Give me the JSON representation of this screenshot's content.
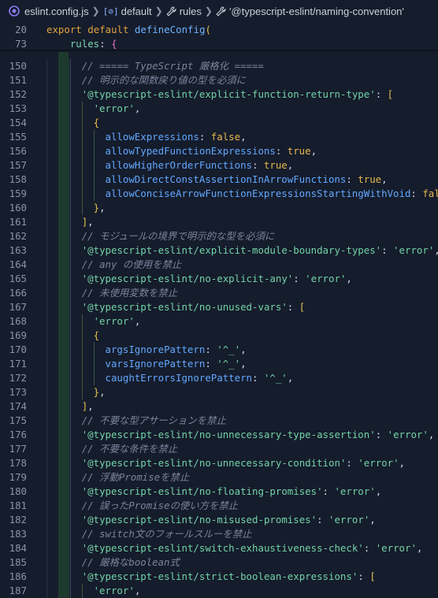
{
  "breadcrumb": {
    "file": "eslint.config.js",
    "items": [
      "default",
      "rules",
      "'@typescript-eslint/naming-convention'"
    ]
  },
  "sticky": [
    {
      "line": "20",
      "tokens": [
        [
          "k",
          "export"
        ],
        [
          "punc",
          " "
        ],
        [
          "k",
          "default"
        ],
        [
          "punc",
          " "
        ],
        [
          "f",
          "defineConfig"
        ],
        [
          "y",
          "("
        ]
      ]
    },
    {
      "line": "73",
      "tokens": [
        [
          "punc",
          "    "
        ],
        [
          "p",
          "rules"
        ],
        [
          "punc",
          ": "
        ],
        [
          "pk",
          "{"
        ]
      ]
    }
  ],
  "lines": [
    {
      "n": "150",
      "indent": 3,
      "tokens": [
        [
          "c",
          "// ===== TypeScript 厳格化 ====="
        ]
      ]
    },
    {
      "n": "151",
      "indent": 3,
      "tokens": [
        [
          "c",
          "// 明示的な関数戻り値の型を必須に"
        ]
      ]
    },
    {
      "n": "152",
      "indent": 3,
      "tokens": [
        [
          "s",
          "'@typescript-eslint/explicit-function-return-type'"
        ],
        [
          "punc",
          ": "
        ],
        [
          "y",
          "["
        ]
      ]
    },
    {
      "n": "153",
      "indent": 4,
      "tokens": [
        [
          "s",
          "'error'"
        ],
        [
          "punc",
          ","
        ]
      ]
    },
    {
      "n": "154",
      "indent": 4,
      "tokens": [
        [
          "y",
          "{"
        ]
      ]
    },
    {
      "n": "155",
      "indent": 5,
      "tokens": [
        [
          "prop",
          "allowExpressions"
        ],
        [
          "punc",
          ": "
        ],
        [
          "bool",
          "false"
        ],
        [
          "punc",
          ","
        ]
      ]
    },
    {
      "n": "156",
      "indent": 5,
      "tokens": [
        [
          "prop",
          "allowTypedFunctionExpressions"
        ],
        [
          "punc",
          ": "
        ],
        [
          "bool",
          "true"
        ],
        [
          "punc",
          ","
        ]
      ]
    },
    {
      "n": "157",
      "indent": 5,
      "tokens": [
        [
          "prop",
          "allowHigherOrderFunctions"
        ],
        [
          "punc",
          ": "
        ],
        [
          "bool",
          "true"
        ],
        [
          "punc",
          ","
        ]
      ]
    },
    {
      "n": "158",
      "indent": 5,
      "tokens": [
        [
          "prop",
          "allowDirectConstAssertionInArrowFunctions"
        ],
        [
          "punc",
          ": "
        ],
        [
          "bool",
          "true"
        ],
        [
          "punc",
          ","
        ]
      ]
    },
    {
      "n": "159",
      "indent": 5,
      "tokens": [
        [
          "prop",
          "allowConciseArrowFunctionExpressionsStartingWithVoid"
        ],
        [
          "punc",
          ": "
        ],
        [
          "bool",
          "false"
        ]
      ]
    },
    {
      "n": "160",
      "indent": 4,
      "tokens": [
        [
          "y",
          "}"
        ],
        [
          "punc",
          ","
        ]
      ]
    },
    {
      "n": "161",
      "indent": 3,
      "tokens": [
        [
          "y",
          "]"
        ],
        [
          "punc",
          ","
        ]
      ]
    },
    {
      "n": "162",
      "indent": 3,
      "tokens": [
        [
          "c",
          "// モジュールの境界で明示的な型を必須に"
        ]
      ]
    },
    {
      "n": "163",
      "indent": 3,
      "tokens": [
        [
          "s",
          "'@typescript-eslint/explicit-module-boundary-types'"
        ],
        [
          "punc",
          ": "
        ],
        [
          "s",
          "'error'"
        ],
        [
          "punc",
          ","
        ]
      ]
    },
    {
      "n": "164",
      "indent": 3,
      "tokens": [
        [
          "c",
          "// any の使用を禁止"
        ]
      ]
    },
    {
      "n": "165",
      "indent": 3,
      "tokens": [
        [
          "s",
          "'@typescript-eslint/no-explicit-any'"
        ],
        [
          "punc",
          ": "
        ],
        [
          "s",
          "'error'"
        ],
        [
          "punc",
          ","
        ]
      ]
    },
    {
      "n": "166",
      "indent": 3,
      "tokens": [
        [
          "c",
          "// 未使用変数を禁止"
        ]
      ]
    },
    {
      "n": "167",
      "indent": 3,
      "tokens": [
        [
          "s",
          "'@typescript-eslint/no-unused-vars'"
        ],
        [
          "punc",
          ": "
        ],
        [
          "y",
          "["
        ]
      ]
    },
    {
      "n": "168",
      "indent": 4,
      "tokens": [
        [
          "s",
          "'error'"
        ],
        [
          "punc",
          ","
        ]
      ]
    },
    {
      "n": "169",
      "indent": 4,
      "tokens": [
        [
          "y",
          "{"
        ]
      ]
    },
    {
      "n": "170",
      "indent": 5,
      "tokens": [
        [
          "prop",
          "argsIgnorePattern"
        ],
        [
          "punc",
          ": "
        ],
        [
          "s",
          "'^_'"
        ],
        [
          "punc",
          ","
        ]
      ]
    },
    {
      "n": "171",
      "indent": 5,
      "tokens": [
        [
          "prop",
          "varsIgnorePattern"
        ],
        [
          "punc",
          ": "
        ],
        [
          "s",
          "'^_'"
        ],
        [
          "punc",
          ","
        ]
      ]
    },
    {
      "n": "172",
      "indent": 5,
      "tokens": [
        [
          "prop",
          "caughtErrorsIgnorePattern"
        ],
        [
          "punc",
          ": "
        ],
        [
          "s",
          "'^_'"
        ],
        [
          "punc",
          ","
        ]
      ]
    },
    {
      "n": "173",
      "indent": 4,
      "tokens": [
        [
          "y",
          "}"
        ],
        [
          "punc",
          ","
        ]
      ]
    },
    {
      "n": "174",
      "indent": 3,
      "tokens": [
        [
          "y",
          "]"
        ],
        [
          "punc",
          ","
        ]
      ]
    },
    {
      "n": "175",
      "indent": 3,
      "tokens": [
        [
          "c",
          "// 不要な型アサーションを禁止"
        ]
      ]
    },
    {
      "n": "176",
      "indent": 3,
      "tokens": [
        [
          "s",
          "'@typescript-eslint/no-unnecessary-type-assertion'"
        ],
        [
          "punc",
          ": "
        ],
        [
          "s",
          "'error'"
        ],
        [
          "punc",
          ","
        ]
      ]
    },
    {
      "n": "177",
      "indent": 3,
      "tokens": [
        [
          "c",
          "// 不要な条件を禁止"
        ]
      ]
    },
    {
      "n": "178",
      "indent": 3,
      "tokens": [
        [
          "s",
          "'@typescript-eslint/no-unnecessary-condition'"
        ],
        [
          "punc",
          ": "
        ],
        [
          "s",
          "'error'"
        ],
        [
          "punc",
          ","
        ]
      ]
    },
    {
      "n": "179",
      "indent": 3,
      "tokens": [
        [
          "c",
          "// 浮動Promiseを禁止"
        ]
      ]
    },
    {
      "n": "180",
      "indent": 3,
      "tokens": [
        [
          "s",
          "'@typescript-eslint/no-floating-promises'"
        ],
        [
          "punc",
          ": "
        ],
        [
          "s",
          "'error'"
        ],
        [
          "punc",
          ","
        ]
      ]
    },
    {
      "n": "181",
      "indent": 3,
      "tokens": [
        [
          "c",
          "// 誤ったPromiseの使い方を禁止"
        ]
      ]
    },
    {
      "n": "182",
      "indent": 3,
      "tokens": [
        [
          "s",
          "'@typescript-eslint/no-misused-promises'"
        ],
        [
          "punc",
          ": "
        ],
        [
          "s",
          "'error'"
        ],
        [
          "punc",
          ","
        ]
      ]
    },
    {
      "n": "183",
      "indent": 3,
      "tokens": [
        [
          "c",
          "// switch文のフォールスルーを禁止"
        ]
      ]
    },
    {
      "n": "184",
      "indent": 3,
      "tokens": [
        [
          "s",
          "'@typescript-eslint/switch-exhaustiveness-check'"
        ],
        [
          "punc",
          ": "
        ],
        [
          "s",
          "'error'"
        ],
        [
          "punc",
          ","
        ]
      ]
    },
    {
      "n": "185",
      "indent": 3,
      "tokens": [
        [
          "c",
          "// 厳格なboolean式"
        ]
      ]
    },
    {
      "n": "186",
      "indent": 3,
      "tokens": [
        [
          "s",
          "'@typescript-eslint/strict-boolean-expressions'"
        ],
        [
          "punc",
          ": "
        ],
        [
          "y",
          "["
        ]
      ]
    },
    {
      "n": "187",
      "indent": 4,
      "tokens": [
        [
          "s",
          "'error'"
        ],
        [
          "punc",
          ","
        ]
      ]
    }
  ],
  "colors": {
    "background": "#151c2c",
    "string": "#73d3a6",
    "comment": "#7a849b",
    "keyword": "#e0a340",
    "property": "#62a8ff",
    "boolean": "#e6b94f"
  },
  "icons": [
    "eslint-file-icon",
    "symbol-object-icon",
    "wrench-icon",
    "wrench-icon"
  ]
}
